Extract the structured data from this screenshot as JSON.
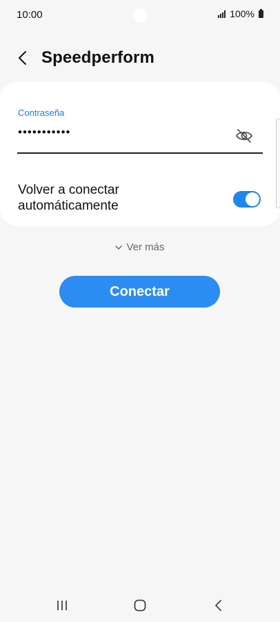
{
  "status_bar": {
    "time": "10:00",
    "battery": "100%"
  },
  "header": {
    "title": "Speedperform"
  },
  "password_field": {
    "label": "Contraseña",
    "value": "•••••••••••"
  },
  "auto_reconnect": {
    "label": "Volver a conectar automáticamente",
    "enabled": true
  },
  "ver_mas": {
    "label": "Ver más"
  },
  "connect_button": {
    "label": "Conectar"
  },
  "colors": {
    "accent": "#1f85ef",
    "label_blue": "#1a7be0",
    "background": "#f6f6f6"
  },
  "icons": [
    "back-arrow-icon",
    "eye-off-icon",
    "chevron-down-icon",
    "nav-recents-icon",
    "nav-home-icon",
    "nav-back-icon",
    "signal-icon",
    "battery-icon"
  ]
}
